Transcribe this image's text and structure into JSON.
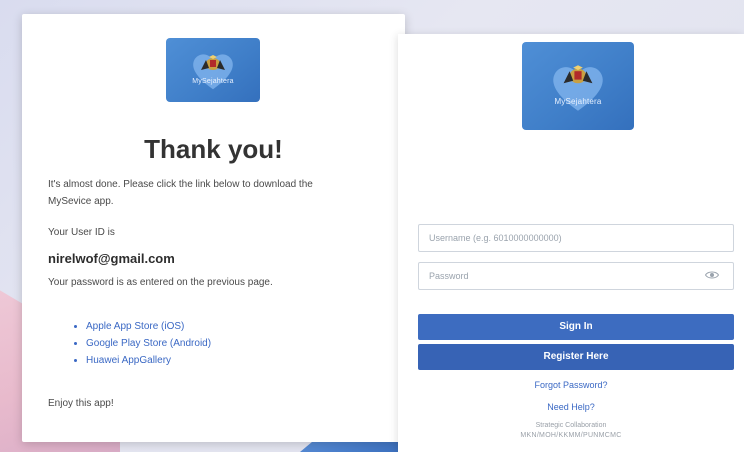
{
  "colors": {
    "primary_button": "#3d6cc0",
    "link": "#3a68c4",
    "logo_bg": "#4f8fd6"
  },
  "logo": {
    "brand_text": "MySejahtera",
    "icon": "heart-crest-icon"
  },
  "thank_you_card": {
    "title": "Thank you!",
    "intro": "It's almost done. Please click the link below to download the MySevice app.",
    "user_id_label": "Your User ID is",
    "user_id": "nirelwof@gmail.com",
    "password_note": "Your password is as entered on the previous page.",
    "store_links": [
      "Apple App Store (iOS)",
      "Google Play Store (Android)",
      "Huawei AppGallery"
    ],
    "closing": "Enjoy this app!"
  },
  "login_card": {
    "username_placeholder": "Username (e.g. 6010000000000)",
    "password_placeholder": "Password",
    "show_password_icon": "eye-icon",
    "sign_in_label": "Sign In",
    "register_label": "Register Here",
    "forgot_label": "Forgot Password?",
    "help_label": "Need Help?",
    "footer_line1": "Strategic Collaboration",
    "footer_line2": "MKN/MOH/KKMM/PUNMCMC"
  }
}
